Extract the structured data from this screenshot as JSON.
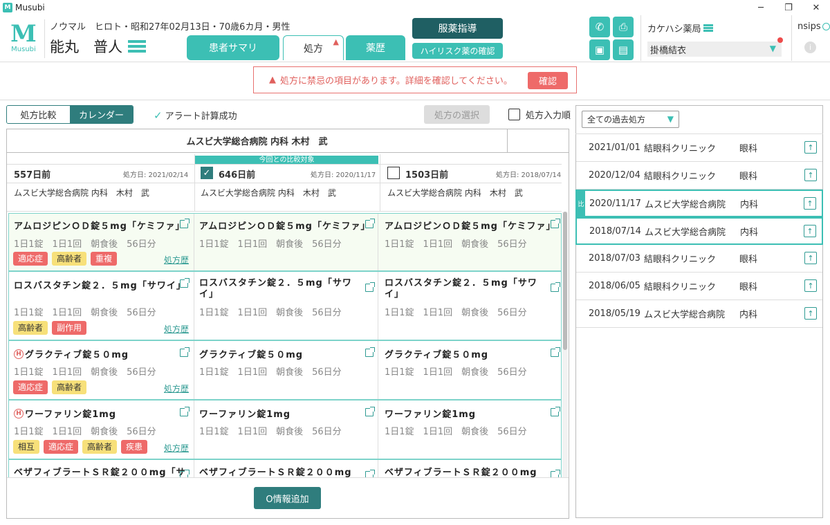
{
  "window": {
    "title": "Musubi",
    "min": "─",
    "max": "❐",
    "close": "✕"
  },
  "logo": {
    "letter": "M",
    "text": "Musubi"
  },
  "patient": {
    "kana": "ノウマル　ヒロト・昭和27年02月13日・70歳6カ月・男性",
    "name": "能丸　普人"
  },
  "tabs": {
    "summary": "患者サマリ",
    "prescription": "処方",
    "history": "薬歴"
  },
  "buttons": {
    "guidance": "服薬指導",
    "highrisk": "ハイリスク薬の確認",
    "add_info": "O情報追加",
    "select": "処方の選択"
  },
  "pharmacy": {
    "name": "カケハシ薬局",
    "staff": "掛橋結衣",
    "nsips": "nsips"
  },
  "alert": {
    "message": "処方に禁忌の項目があります。詳細を確認してください。",
    "confirm": "確認"
  },
  "toolbar": {
    "compare": "処方比較",
    "calendar": "カレンダー",
    "alert_ok": "アラート計算成功",
    "input_order": "処方入力順"
  },
  "main": {
    "hospital_tab": "ムスビ大学総合病院 内科 木村　武",
    "compare_label": "今回との比較対象",
    "columns": [
      {
        "days": "557日前",
        "date": "処方日: 2021/02/14",
        "doctor": "ムスビ大学総合病院 内科　木村　武"
      },
      {
        "days": "646日前",
        "date": "処方日: 2020/11/17",
        "doctor": "ムスビ大学総合病院 内科　木村　武"
      },
      {
        "days": "1503日前",
        "date": "処方日: 2018/07/14",
        "doctor": "ムスビ大学総合病院 内科　木村　武"
      }
    ],
    "history_link": "処方歴",
    "drugs": [
      {
        "name": "アムロジピンＯＤ錠５mg「ケミファ」",
        "name2": "",
        "info": "1日1錠　1日1回　朝食後　56日分",
        "tags": [
          {
            "t": "適応症",
            "c": "red"
          },
          {
            "t": "高齢者",
            "c": "yel"
          },
          {
            "t": "重複",
            "c": "red"
          }
        ],
        "h": false
      },
      {
        "name": "ロスバスタチン錠２．５mg「サワイ」",
        "name2": "ロスバスタチン錠２．５mg「サワ",
        "name2b": "イ」",
        "info": "1日1錠　1日1回　朝食後　56日分",
        "tags": [
          {
            "t": "高齢者",
            "c": "yel"
          },
          {
            "t": "副作用",
            "c": "red"
          }
        ],
        "h": false
      },
      {
        "name": "グラクティブ錠５０mg",
        "info": "1日1錠　1日1回　朝食後　56日分",
        "tags": [
          {
            "t": "適応症",
            "c": "red"
          },
          {
            "t": "高齢者",
            "c": "yel"
          }
        ],
        "h": true
      },
      {
        "name": "ワーファリン錠1mg",
        "info": "1日1錠　1日1回　朝食後　56日分",
        "tags": [
          {
            "t": "相互",
            "c": "yel"
          },
          {
            "t": "適応症",
            "c": "red"
          },
          {
            "t": "高齢者",
            "c": "yel"
          },
          {
            "t": "疾患",
            "c": "red"
          }
        ],
        "h": true
      },
      {
        "name": "ベザフィブラートＳＲ錠２００mg「サ",
        "name_other": "ベザフィブラートＳＲ錠２００mg",
        "info": "",
        "tags": [],
        "h": false
      }
    ]
  },
  "right": {
    "dropdown": "全ての過去処方",
    "compare_marker": "比",
    "rows": [
      {
        "date": "2021/01/01",
        "clinic": "結眼科クリニック",
        "dept": "眼科"
      },
      {
        "date": "2020/12/04",
        "clinic": "結眼科クリニック",
        "dept": "眼科"
      },
      {
        "date": "2020/11/17",
        "clinic": "ムスビ大学総合病院",
        "dept": "内科"
      },
      {
        "date": "2018/07/14",
        "clinic": "ムスビ大学総合病院",
        "dept": "内科"
      },
      {
        "date": "2018/07/03",
        "clinic": "結眼科クリニック",
        "dept": "眼科"
      },
      {
        "date": "2018/06/05",
        "clinic": "結眼科クリニック",
        "dept": "眼科"
      },
      {
        "date": "2018/05/19",
        "clinic": "ムスビ大学総合病院",
        "dept": "内科"
      }
    ]
  },
  "colors": {
    "accent": "#3cbfb4",
    "dark": "#1f5f63",
    "alert": "#ee6a69",
    "tag_yellow": "#f7e07a"
  },
  "icons": [
    "phone-icon",
    "print-icon",
    "image-icon",
    "document-icon",
    "list-icon",
    "external-link-icon",
    "upload-icon",
    "warning-icon",
    "check-icon",
    "info-icon"
  ]
}
